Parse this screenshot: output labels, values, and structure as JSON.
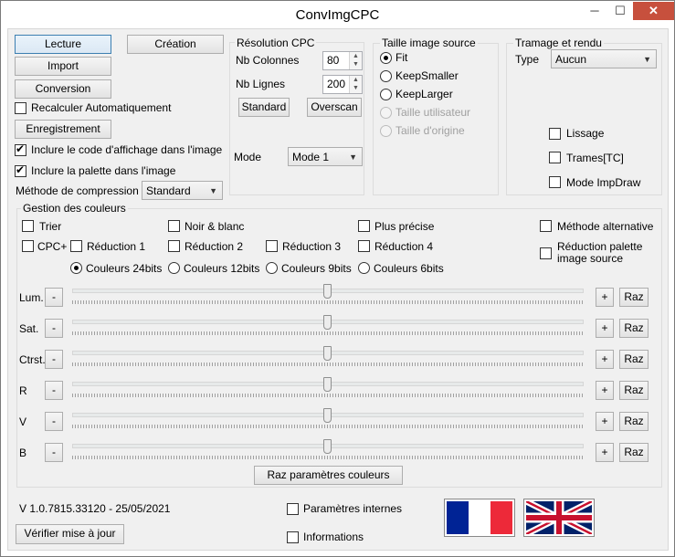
{
  "window": {
    "title": "ConvImgCPC",
    "minimize": "─",
    "maximize": "☐",
    "close": "✕"
  },
  "left": {
    "lecture": "Lecture",
    "creation": "Création",
    "import": "Import",
    "conversion": "Conversion",
    "recalc": "Recalculer Automatiquement",
    "enregistrement": "Enregistrement",
    "incl_code": "Inclure le code d'affichage dans l'image",
    "incl_palette": "Inclure la palette dans l'image",
    "compression_label": "Méthode de compression",
    "compression_value": "Standard"
  },
  "resolution": {
    "title": "Résolution CPC",
    "cols_label": "Nb Colonnes",
    "cols_value": "80",
    "rows_label": "Nb Lignes",
    "rows_value": "200",
    "standard": "Standard",
    "overscan": "Overscan",
    "mode_label": "Mode",
    "mode_value": "Mode 1"
  },
  "taille": {
    "title": "Taille image source",
    "fit": "Fit",
    "keepsmaller": "KeepSmaller",
    "keeplarger": "KeepLarger",
    "utilisateur": "Taille utilisateur",
    "origine": "Taille d'origine"
  },
  "tramage": {
    "title": "Tramage et rendu",
    "type_label": "Type",
    "type_value": "Aucun",
    "lissage": "Lissage",
    "trames": "Trames[TC]",
    "impdraw": "Mode ImpDraw"
  },
  "couleurs": {
    "title": "Gestion des couleurs",
    "trier": "Trier",
    "noir_blanc": "Noir & blanc",
    "plus_precise": "Plus précise",
    "methode_alt": "Méthode alternative",
    "cpcplus": "CPC+",
    "red1": "Réduction 1",
    "red2": "Réduction 2",
    "red3": "Réduction 3",
    "red4": "Réduction 4",
    "red_palette": "Réduction palette image source",
    "c24": "Couleurs 24bits",
    "c12": "Couleurs 12bits",
    "c9": "Couleurs 9bits",
    "c6": "Couleurs 6bits",
    "minus": "-",
    "plus": "+",
    "raz": "Raz",
    "sliders": [
      {
        "label": "Lum.",
        "value": 0.5
      },
      {
        "label": "Sat.",
        "value": 0.5
      },
      {
        "label": "Ctrst.",
        "value": 0.5
      },
      {
        "label": "R",
        "value": 0.5
      },
      {
        "label": "V",
        "value": 0.5
      },
      {
        "label": "B",
        "value": 0.5
      }
    ],
    "raz_params": "Raz paramètres couleurs"
  },
  "footer": {
    "version": "V 1.0.7815.33120 - 25/05/2021",
    "params_internes": "Paramètres internes",
    "informations": "Informations",
    "verifier": "Vérifier mise à jour"
  },
  "colors": {
    "accent": "#3c7fb1",
    "close_red": "#c7503d",
    "fr_blue": "#002395",
    "fr_red": "#ed2939",
    "uk_blue": "#012169",
    "uk_red": "#c8102e"
  }
}
